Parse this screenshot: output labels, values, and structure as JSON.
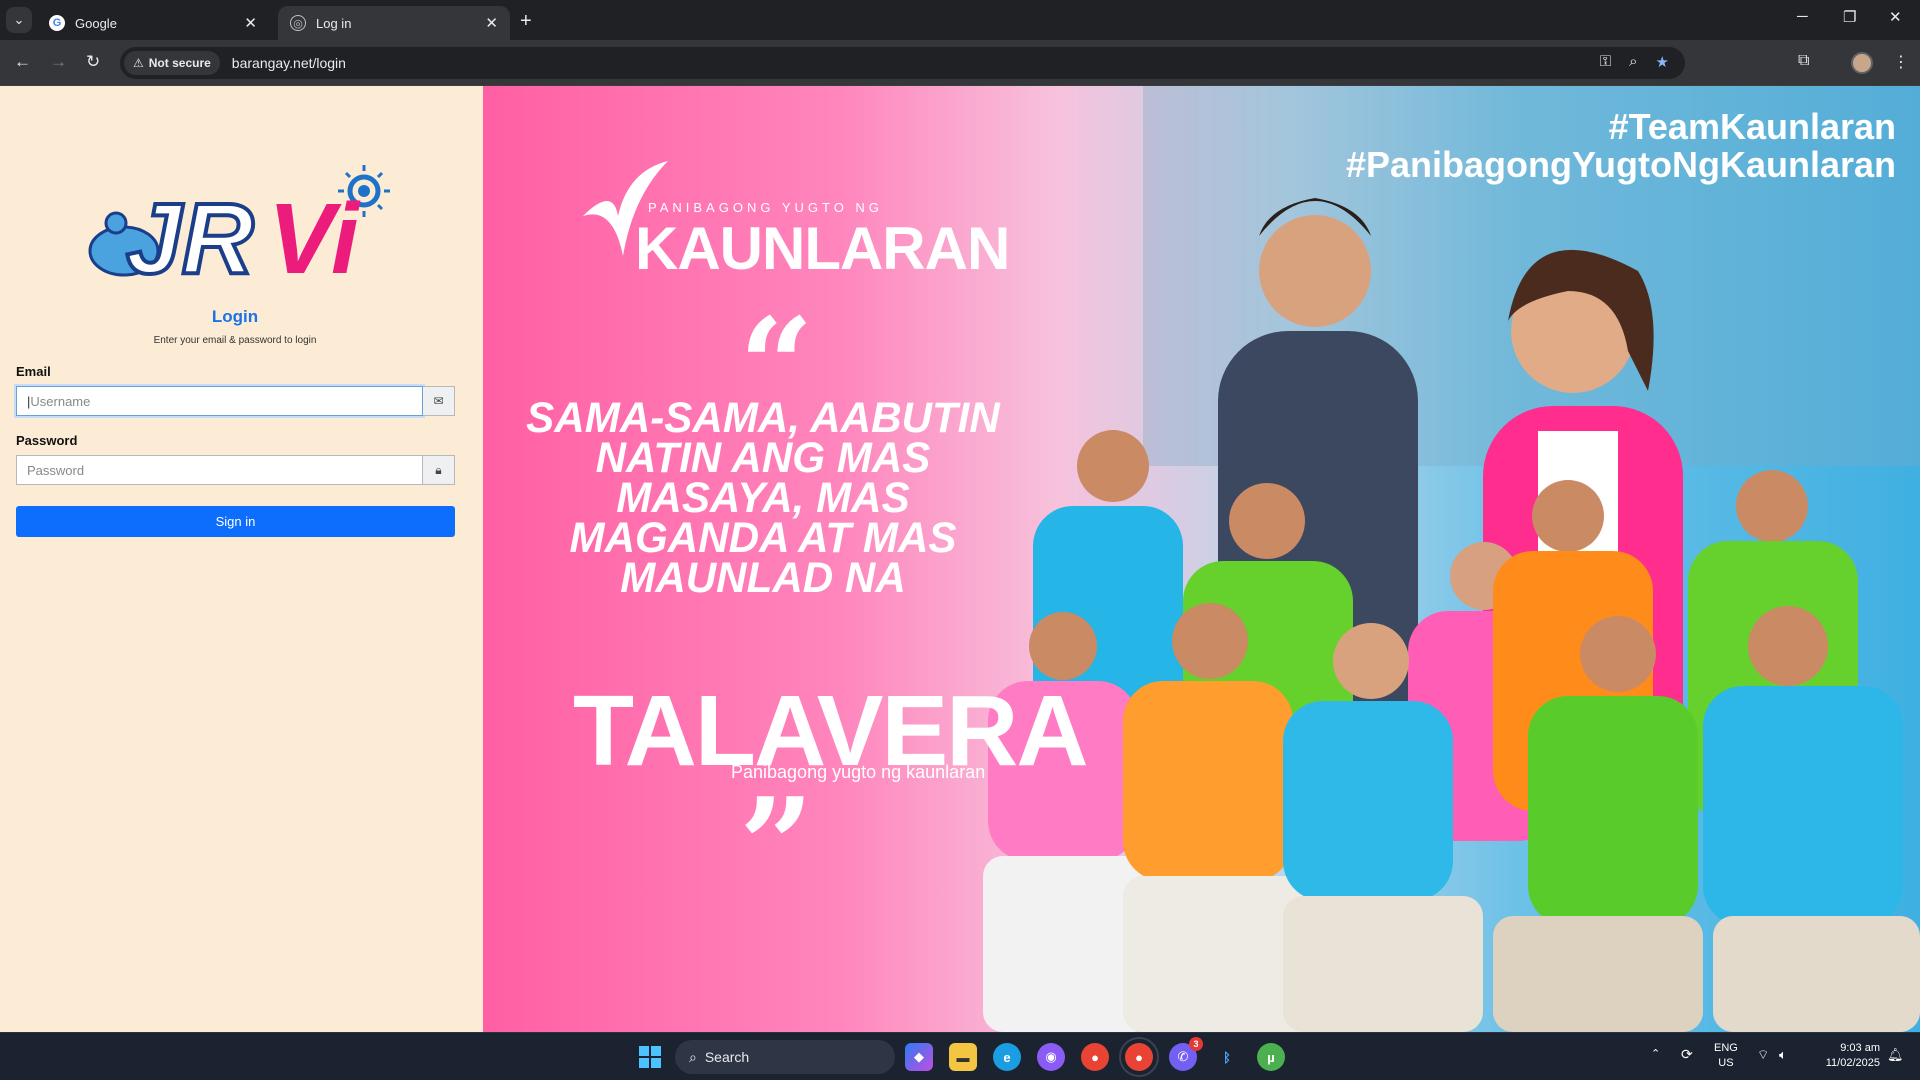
{
  "browser": {
    "tabs": [
      {
        "title": "Google",
        "active": false
      },
      {
        "title": "Log in",
        "active": true
      }
    ],
    "security_badge": "Not secure",
    "url": "barangay.net/login"
  },
  "login": {
    "logo_text": "JRVi",
    "title": "Login",
    "subtitle": "Enter your email & password to login",
    "email_label": "Email",
    "email_placeholder": "Username",
    "password_label": "Password",
    "password_placeholder": "Password",
    "signin_label": "Sign in"
  },
  "banner": {
    "hashtag_1": "#TeamKaunlaran",
    "hashtag_2": "#PanibagongYugtoNgKaunlaran",
    "tagline_small": "PANIBAGONG YUGTO NG",
    "tagline_big": "KAUNLARAN",
    "quote_lines": [
      "SAMA-SAMA, AABUTIN",
      "NATIN ANG MAS",
      "MASAYA, MAS",
      "MAGANDA AT MAS",
      "MAUNLAD NA"
    ],
    "town": "TALAVERA",
    "town_sub": "Panibagong yugto ng kaunlaran",
    "colors": {
      "pink": "#ff5fa3",
      "blue": "#3fb0e2"
    }
  },
  "taskbar": {
    "search_label": "Search",
    "language": "ENG",
    "region": "US",
    "time": "9:03 am",
    "date": "11/02/2025",
    "viber_badge": "3"
  }
}
